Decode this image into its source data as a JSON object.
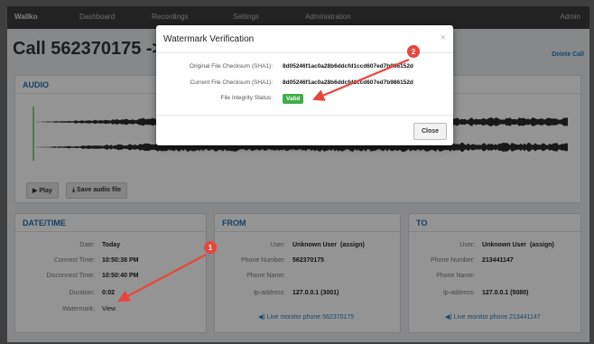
{
  "nav": {
    "logo": "Wallko",
    "items": [
      "Dashboard",
      "Recordings",
      "Settings",
      "Administration"
    ],
    "user_menu": "Admin"
  },
  "page": {
    "title": "Call 562370175 -> 2",
    "delete_label": "Delete Call"
  },
  "audio": {
    "heading": "AUDIO",
    "play_label": "▶ Play",
    "save_label": "⤓ Save audio file"
  },
  "datetime": {
    "heading": "DATE/TIME",
    "rows": [
      {
        "label": "Date:",
        "value": "Today"
      },
      {
        "label": "Connect Time:",
        "value": "10:50:38 PM"
      },
      {
        "label": "Disconnect Time:",
        "value": "10:50:40 PM"
      },
      {
        "label": "Duration:",
        "value": "0:02"
      },
      {
        "label": "Watermark:",
        "value": "View"
      }
    ]
  },
  "from": {
    "heading": "FROM",
    "user_label": "User:",
    "user_value": "Unknown User",
    "assign_label": "(assign)",
    "phone_label": "Phone Number:",
    "phone_value": "562370175",
    "name_label": "Phone Name:",
    "name_value": "",
    "ip_label": "Ip-address:",
    "ip_value": "127.0.0.1 (3001)",
    "monitor_label": "◀) Live monitor phone 562370175"
  },
  "to": {
    "heading": "TO",
    "user_label": "User:",
    "user_value": "Unknown User",
    "assign_label": "(assign)",
    "phone_label": "Phone Number:",
    "phone_value": "213441147",
    "name_label": "Phone Name:",
    "name_value": "",
    "ip_label": "Ip-address:",
    "ip_value": "127.0.0.1 (5080)",
    "monitor_label": "◀) Live monitor phone 213441147"
  },
  "modal": {
    "title": "Watermark Verification",
    "close_x": "×",
    "original_label": "Original File Checksum (SHA1):",
    "original_value": "8d05246f1ac0a28b6ddcfd1ccd607ed7b986152d",
    "current_label": "Current File Checksum (SHA1):",
    "current_value": "8d05246f1ac0a28b6ddcfd1ccd607ed7b986152d",
    "status_label": "File Integrity Status:",
    "status_value": "Valid",
    "close_button": "Close"
  },
  "annotations": {
    "marker_1": "1",
    "marker_2": "2",
    "color": "#e8453c"
  }
}
